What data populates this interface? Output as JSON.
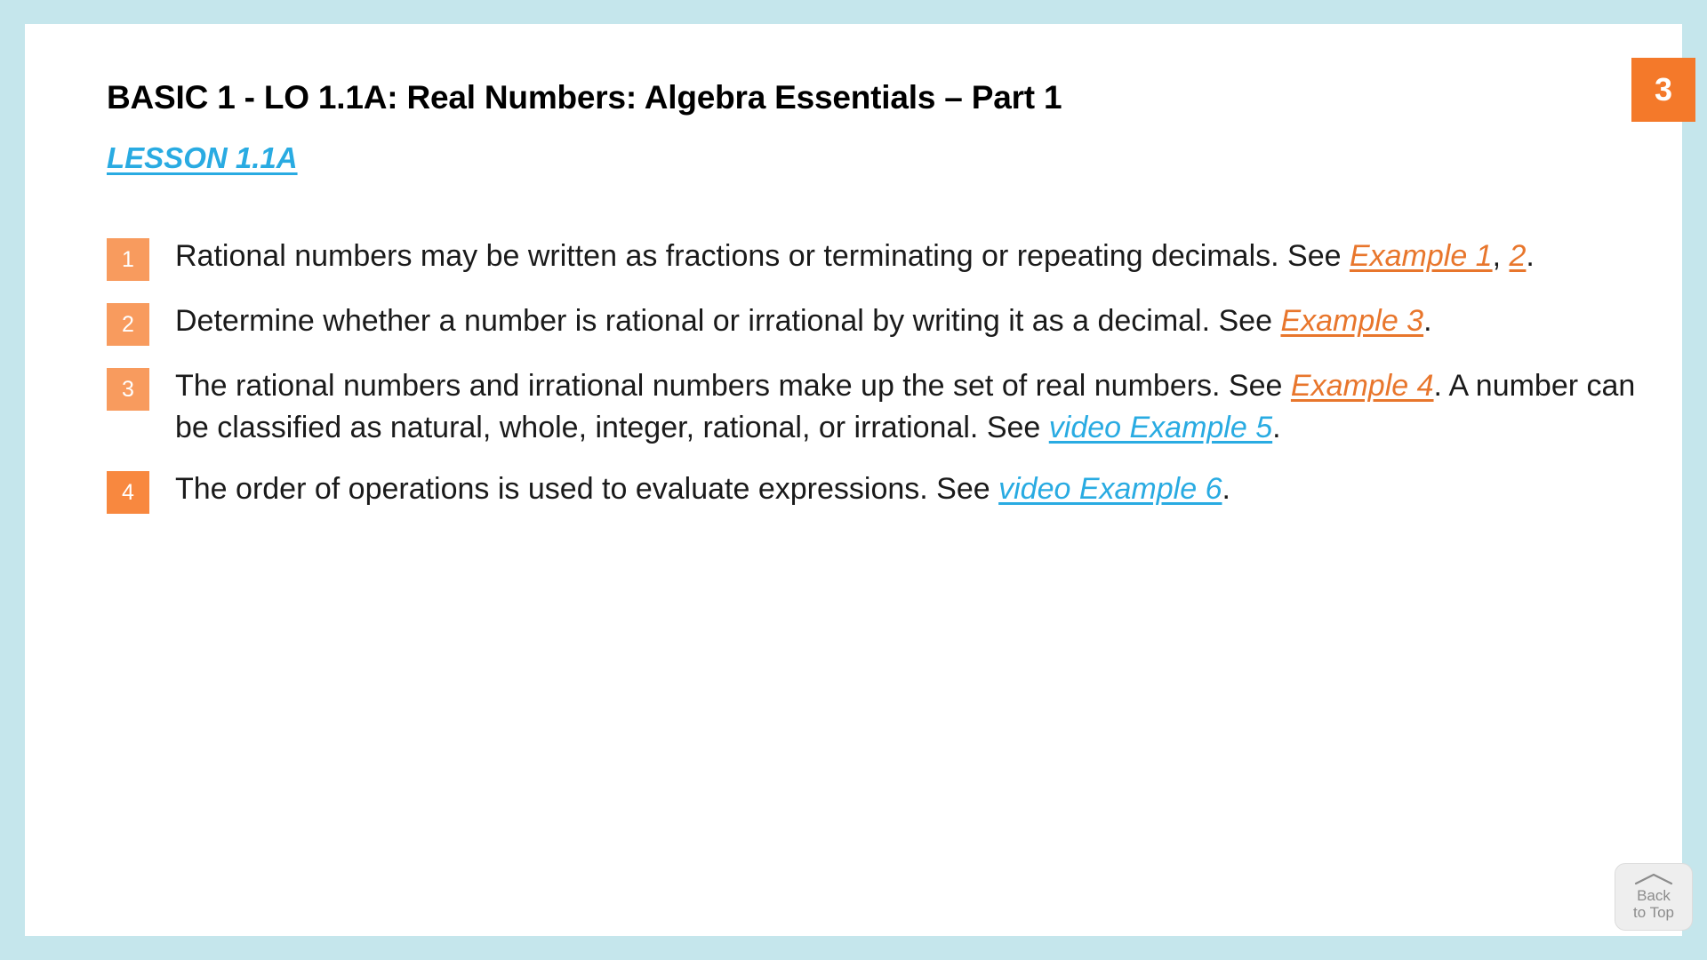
{
  "theme": {
    "frame_color": "#c5e6ec",
    "canvas_color": "#ffffff",
    "badge_orange": "#f89b5e",
    "page_badge_orange": "#f4792a",
    "link_orange": "#e8762c",
    "link_blue": "#29abe2",
    "text_color": "#1a1a1a"
  },
  "header": {
    "title": "BASIC 1 - LO 1.1A:  Real Numbers: Algebra Essentials – Part 1",
    "lesson_link": "LESSON 1.1A",
    "page_number": "3"
  },
  "bullets": [
    {
      "number": "1",
      "segments": [
        {
          "kind": "text",
          "value": "Rational numbers may be written as fractions or terminating or repeating decimals. See "
        },
        {
          "kind": "link-orange",
          "value": "Example 1"
        },
        {
          "kind": "text",
          "value": ", "
        },
        {
          "kind": "link-orange",
          "value": "2"
        },
        {
          "kind": "text",
          "value": "."
        }
      ]
    },
    {
      "number": "2",
      "segments": [
        {
          "kind": "text",
          "value": "Determine whether a number is rational or irrational by writing it as a decimal. See "
        },
        {
          "kind": "link-orange",
          "value": "Example 3"
        },
        {
          "kind": "text",
          "value": "."
        }
      ]
    },
    {
      "number": "3",
      "segments": [
        {
          "kind": "text",
          "value": "The rational numbers and irrational numbers make up the set of real numbers. See "
        },
        {
          "kind": "link-orange",
          "value": "Example 4"
        },
        {
          "kind": "text",
          "value": ". A number can be classified as natural, whole, integer, rational, or irrational. See "
        },
        {
          "kind": "link-blue",
          "value": "video Example 5"
        },
        {
          "kind": "text",
          "value": "."
        }
      ]
    },
    {
      "number": "4",
      "segments": [
        {
          "kind": "text",
          "value": "The order of operations is used to evaluate expressions. See "
        },
        {
          "kind": "link-blue",
          "value": "video Example 6"
        },
        {
          "kind": "text",
          "value": "."
        }
      ]
    }
  ],
  "back_to_top": {
    "label": "Back\nto Top",
    "icon": "chevron-up-icon"
  }
}
